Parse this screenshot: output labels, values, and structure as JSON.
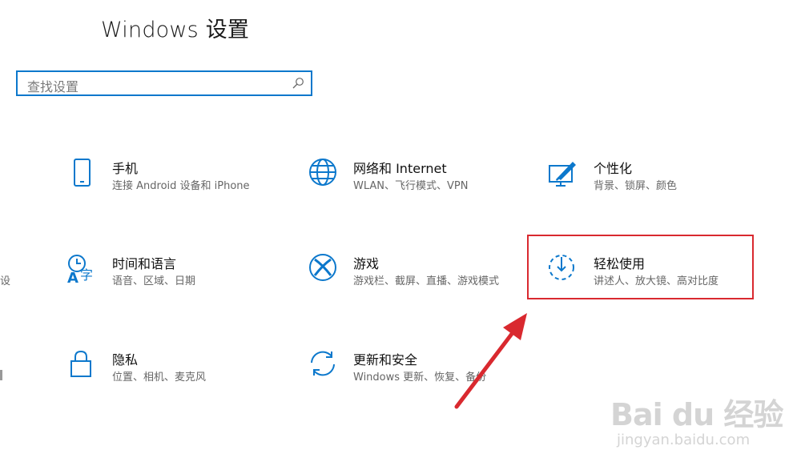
{
  "window": {
    "title": "Windows 设置"
  },
  "search": {
    "placeholder": "查找设置"
  },
  "tiles": [
    {
      "name": "手机",
      "desc": "连接 Android 设备和 iPhone",
      "icon": "phone-icon"
    },
    {
      "name": "网络和 Internet",
      "desc": "WLAN、飞行模式、VPN",
      "icon": "globe-icon"
    },
    {
      "name": "个性化",
      "desc": "背景、锁屏、颜色",
      "icon": "personalization-icon"
    },
    {
      "name": "时间和语言",
      "desc": "语音、区域、日期",
      "icon": "time-language-icon"
    },
    {
      "name": "游戏",
      "desc": "游戏栏、截屏、直播、游戏模式",
      "icon": "xbox-icon"
    },
    {
      "name": "轻松使用",
      "desc": "讲述人、放大镜、高对比度",
      "icon": "ease-of-access-icon"
    },
    {
      "name": "隐私",
      "desc": "位置、相机、麦克风",
      "icon": "lock-icon"
    },
    {
      "name": "更新和安全",
      "desc": "Windows 更新、恢复、备份",
      "icon": "update-icon"
    }
  ],
  "left_cut_text": "设",
  "watermark": {
    "brand": "Bai du 经验",
    "url": "jingyan.baidu.com"
  },
  "colors": {
    "accent": "#0c78cc",
    "highlight": "#d9292f"
  }
}
